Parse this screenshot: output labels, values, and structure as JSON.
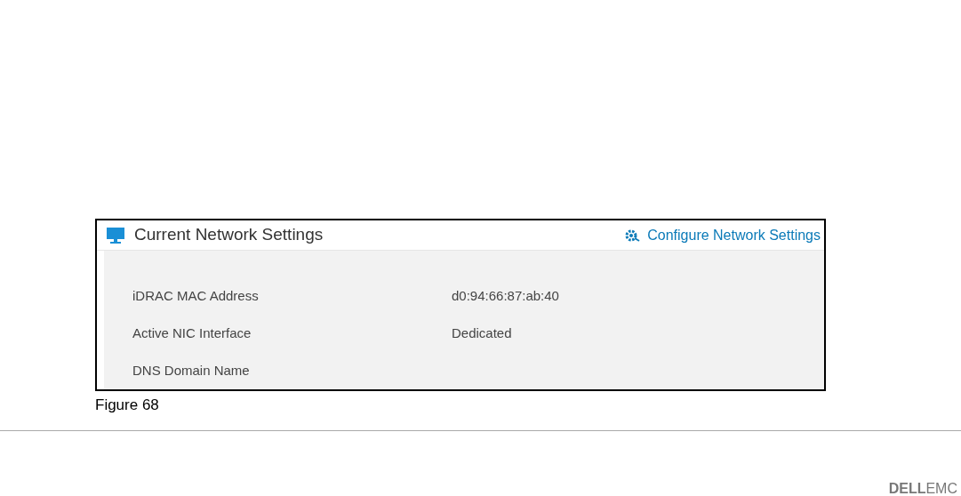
{
  "panel": {
    "title": "Current Network Settings",
    "action_link": "Configure Network Settings",
    "rows": [
      {
        "label": "iDRAC MAC Address",
        "value": "d0:94:66:87:ab:40"
      },
      {
        "label": "Active NIC Interface",
        "value": "Dedicated"
      },
      {
        "label": "DNS Domain Name"
      }
    ]
  },
  "caption": "Figure 68",
  "footer": {
    "logo": "**DELL**EMC"
  }
}
